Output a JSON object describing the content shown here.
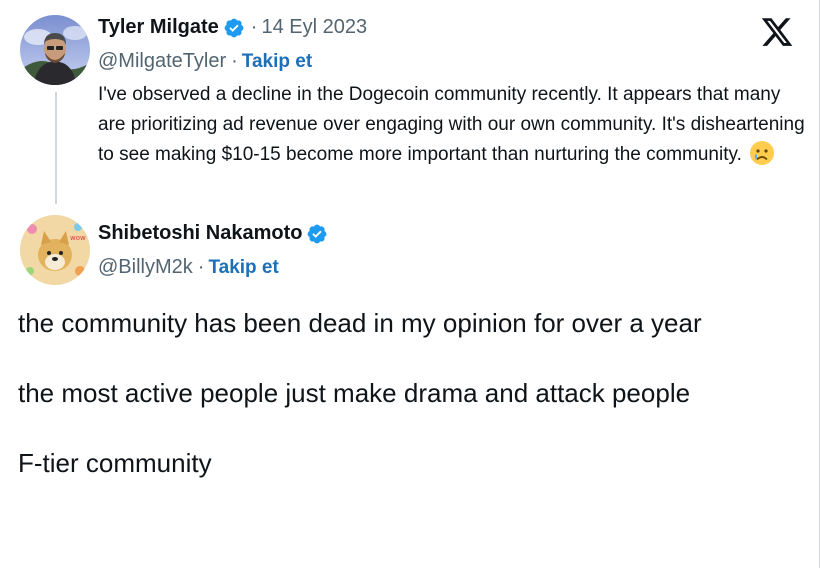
{
  "brand": {
    "logo_icon": "x-logo-icon"
  },
  "quoted_tweet": {
    "author_name": "Tyler Milgate",
    "separator": "·",
    "date": "14 Eyl 2023",
    "handle": "@MilgateTyler",
    "follow_label": "Takip et",
    "text": "I've observed a decline in the Dogecoin community recently. It appears that many are prioritizing ad revenue over engaging with our own community. It's disheartening to see making $10-15 become more important than nurturing the community.",
    "emoji": "crying-face-emoji"
  },
  "reply_tweet": {
    "author_name": "Shibetoshi Nakamoto",
    "handle": "@BillyM2k",
    "separator": "·",
    "follow_label": "Takip et",
    "paragraphs": [
      "the community has been dead in my opinion for over a year",
      "the most active people just make drama and attack people",
      "F-tier community"
    ]
  },
  "colors": {
    "accent": "#1d9bf0",
    "follow_link": "#1d6fb8",
    "secondary_text": "#536471",
    "thread_line": "#cfd9de"
  }
}
